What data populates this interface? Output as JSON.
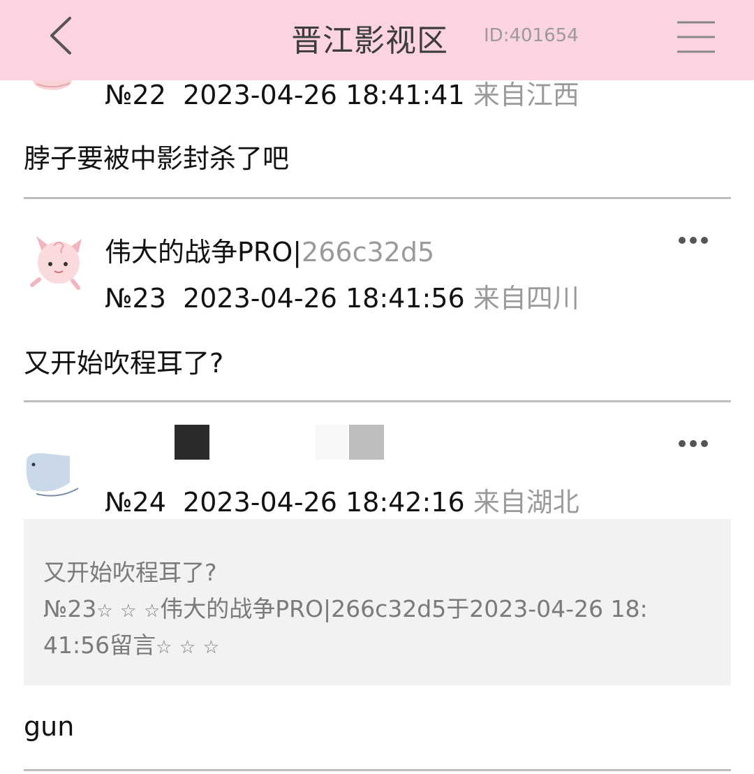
{
  "header": {
    "title": "晋江影视区",
    "id_text": "ID:401654"
  },
  "posts": [
    {
      "floor": "№22",
      "datetime": "2023-04-26 18:41:41",
      "location": "来自江西",
      "content": "脖子要被中影封杀了吧"
    },
    {
      "username": "伟大的战争PRO|",
      "user_id": "266c32d5",
      "floor": "№23",
      "datetime": "2023-04-26 18:41:56",
      "location": "来自四川",
      "content": "又开始吹程耳了?"
    },
    {
      "floor": "№24",
      "datetime": "2023-04-26 18:42:16",
      "location": "来自湖北",
      "quote": {
        "text": "又开始吹程耳了?",
        "ref_floor": "№23",
        "ref_author": "伟大的战争PRO|266c32d5于2023-04-26 18:",
        "ref_time_tail": "41:56留言",
        "star": "☆"
      },
      "content": "gun"
    }
  ],
  "colors": {
    "header_bg": "#fcd3e2",
    "muted_text": "#9a9a9a",
    "quote_bg": "#f2f2f2"
  }
}
